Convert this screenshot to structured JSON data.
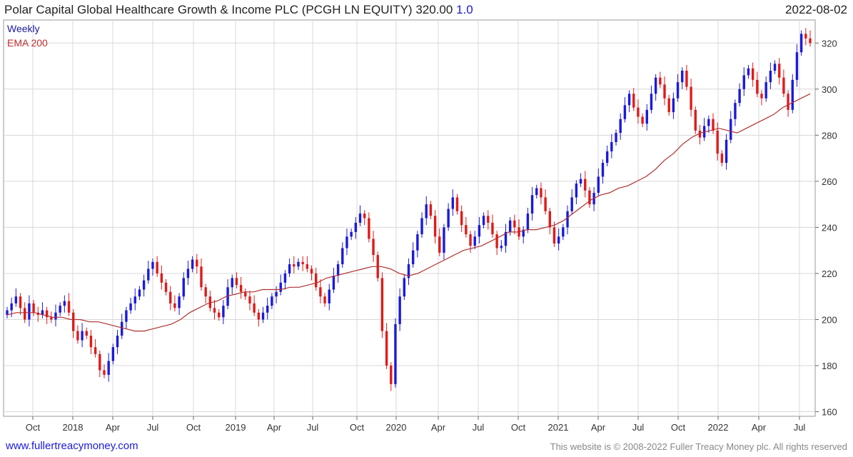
{
  "header": {
    "title": "Polar Capital Global Healthcare Growth & Income PLC (PCGH LN EQUITY)",
    "price": "320.00",
    "change": "1.0",
    "date": "2022-08-02"
  },
  "legend": {
    "period": "Weekly",
    "ma": "EMA 200"
  },
  "footer": {
    "website": "www.fullertreacymoney.com",
    "copyright": "This website is © 2008-2022 Fuller Treacy Money plc. All rights reserved"
  },
  "colors": {
    "up": "#1a1adc",
    "down": "#e01a1a",
    "ema": "#b03030",
    "grid": "#d8d8d8"
  },
  "chart_data": {
    "type": "candlestick",
    "period": "weekly",
    "ylim": [
      158,
      330
    ],
    "yticks": [
      160,
      180,
      200,
      220,
      240,
      260,
      280,
      300,
      320
    ],
    "x_tick_labels": [
      "Oct",
      "2018",
      "Apr",
      "Jul",
      "Oct",
      "2019",
      "Apr",
      "Jul",
      "Oct",
      "2020",
      "Apr",
      "Jul",
      "Oct",
      "2021",
      "Apr",
      "Jul",
      "Oct",
      "2022",
      "Apr",
      "Jul"
    ],
    "grid": true,
    "close_approx": [
      204,
      207,
      210,
      205,
      200,
      207,
      203,
      202,
      204,
      201,
      200,
      203,
      206,
      208,
      203,
      195,
      191,
      195,
      193,
      188,
      185,
      178,
      176,
      182,
      188,
      193,
      199,
      204,
      207,
      210,
      213,
      217,
      222,
      225,
      220,
      216,
      212,
      207,
      205,
      210,
      218,
      222,
      226,
      223,
      214,
      210,
      205,
      203,
      201,
      206,
      214,
      218,
      215,
      212,
      210,
      207,
      203,
      200,
      203,
      206,
      210,
      212,
      216,
      220,
      224,
      223,
      225,
      224,
      222,
      220,
      214,
      210,
      207,
      213,
      219,
      224,
      231,
      236,
      238,
      242,
      246,
      244,
      235,
      228,
      218,
      195,
      180,
      172,
      198,
      210,
      218,
      224,
      230,
      237,
      244,
      250,
      245,
      236,
      229,
      240,
      248,
      253,
      247,
      241,
      237,
      232,
      236,
      241,
      245,
      242,
      237,
      231,
      232,
      238,
      243,
      240,
      236,
      239,
      246,
      254,
      257,
      253,
      247,
      240,
      233,
      236,
      240,
      247,
      253,
      259,
      261,
      256,
      250,
      255,
      262,
      268,
      273,
      277,
      281,
      287,
      293,
      298,
      292,
      288,
      285,
      291,
      298,
      305,
      302,
      296,
      290,
      296,
      303,
      308,
      301,
      291,
      282,
      279,
      284,
      287,
      282,
      272,
      268,
      278,
      287,
      294,
      300,
      306,
      309,
      304,
      298,
      296,
      303,
      308,
      311,
      305,
      298,
      291,
      304,
      316,
      324,
      322,
      320
    ],
    "ema_approx": [
      202,
      203,
      203,
      203,
      202,
      201,
      201,
      200,
      200,
      199,
      199,
      198,
      197,
      196,
      195,
      195,
      196,
      197,
      198,
      200,
      203,
      205,
      207,
      208,
      210,
      211,
      212,
      212,
      213,
      213,
      213,
      214,
      214,
      215,
      216,
      218,
      219,
      220,
      221,
      222,
      223,
      223,
      222,
      220,
      219,
      220,
      222,
      224,
      226,
      228,
      230,
      231,
      232,
      234,
      236,
      238,
      238,
      239,
      239,
      240,
      241,
      243,
      246,
      249,
      252,
      254,
      255,
      257,
      258,
      260,
      262,
      265,
      269,
      272,
      276,
      279,
      281,
      282,
      283,
      282,
      281,
      283,
      285,
      287,
      289,
      292,
      294,
      296,
      298
    ]
  }
}
